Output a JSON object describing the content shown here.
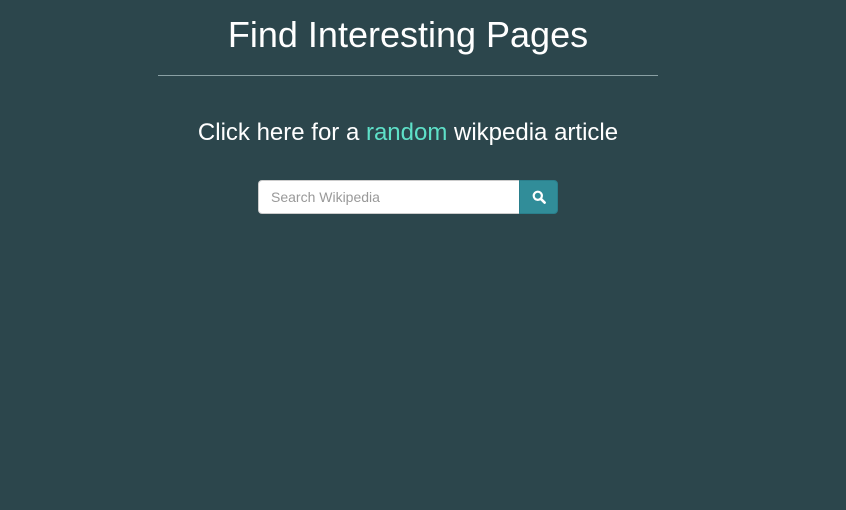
{
  "header": {
    "title": "Find Interesting Pages"
  },
  "random": {
    "prefix": "Click here for a ",
    "link_label": "random",
    "suffix": " wikpedia article",
    "link_color": "#5ee0c8"
  },
  "search": {
    "placeholder": "Search Wikipedia",
    "value": "",
    "button_icon": "search-icon"
  },
  "colors": {
    "background": "#2c464c",
    "button": "#318d99",
    "text": "#ffffff"
  }
}
